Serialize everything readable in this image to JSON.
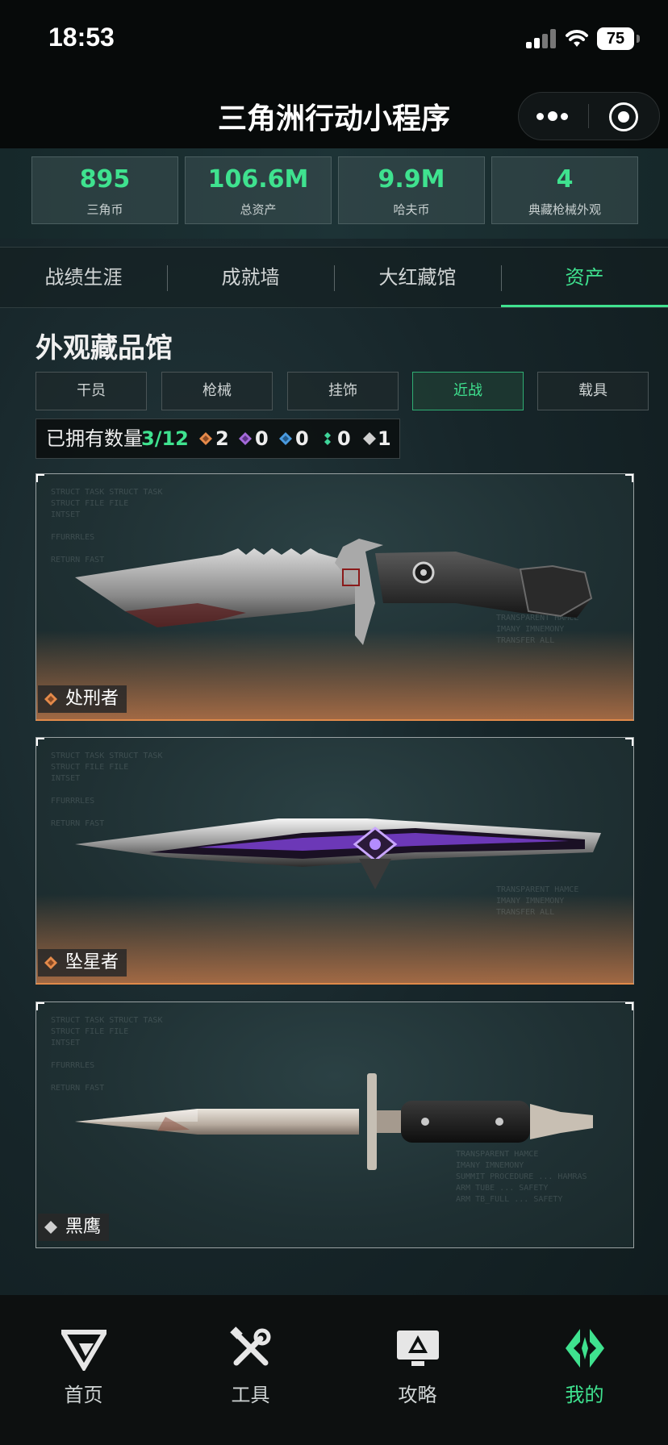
{
  "status_bar": {
    "time": "18:53",
    "battery": "75"
  },
  "nav": {
    "title": "三角洲行动小程序"
  },
  "stats": [
    {
      "value": "895",
      "label": "三角币"
    },
    {
      "value": "106.6M",
      "label": "总资产"
    },
    {
      "value": "9.9M",
      "label": "哈夫币"
    },
    {
      "value": "4",
      "label": "典藏枪械外观"
    }
  ],
  "tabs": [
    {
      "label": "战绩生涯"
    },
    {
      "label": "成就墙"
    },
    {
      "label": "大红藏馆"
    },
    {
      "label": "资产",
      "active": true
    }
  ],
  "section": {
    "title": "外观藏品馆"
  },
  "subtabs": [
    {
      "label": "干员"
    },
    {
      "label": "枪械"
    },
    {
      "label": "挂饰"
    },
    {
      "label": "近战",
      "active": true
    },
    {
      "label": "载具"
    }
  ],
  "owned": {
    "label": "已拥有数量",
    "count": "3/12",
    "rarities": [
      {
        "count": "2",
        "icon": "orange-diamond-icon",
        "color": "#e58a4a"
      },
      {
        "count": "0",
        "icon": "purple-diamond-icon",
        "color": "#a46ad9"
      },
      {
        "count": "0",
        "icon": "blue-diamond-icon",
        "color": "#4a9be0"
      },
      {
        "count": "0",
        "icon": "green-diamond-icon",
        "color": "#3fd59a"
      },
      {
        "count": "1",
        "icon": "white-diamond-icon",
        "color": "#cfcfcf"
      }
    ]
  },
  "items": [
    {
      "name": "处刑者",
      "rarity_color": "#e58a4a",
      "highlight": "orange"
    },
    {
      "name": "坠星者",
      "rarity_color": "#e58a4a",
      "highlight": "orange"
    },
    {
      "name": "黑鹰",
      "rarity_color": "#cfcfcf",
      "highlight": "none"
    }
  ],
  "bottom_nav": [
    {
      "label": "首页",
      "icon": "delta-logo-icon"
    },
    {
      "label": "工具",
      "icon": "tools-icon"
    },
    {
      "label": "攻略",
      "icon": "guide-monitor-icon"
    },
    {
      "label": "我的",
      "icon": "profile-arrows-icon",
      "active": true
    }
  ],
  "colors": {
    "accent": "#3fe28f",
    "orange": "#e58a4a"
  }
}
